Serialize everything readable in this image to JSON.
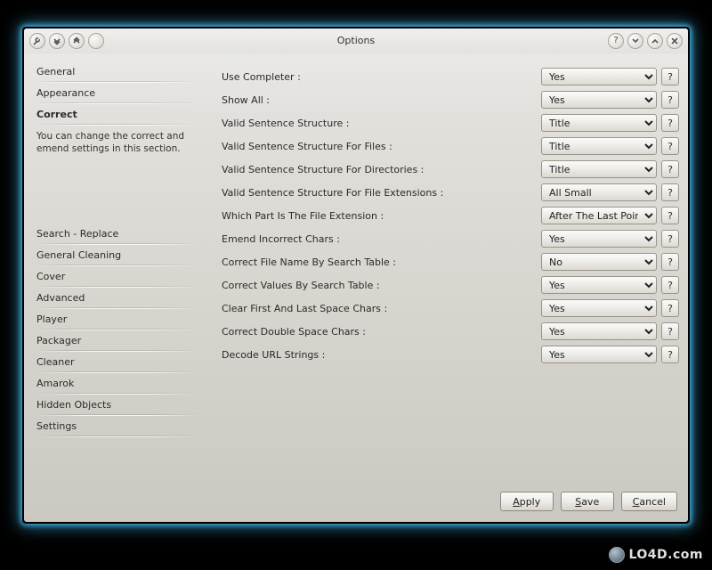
{
  "window": {
    "title": "Options"
  },
  "sidebar": {
    "tabs_top": [
      {
        "label": "General"
      },
      {
        "label": "Appearance"
      },
      {
        "label": "Correct",
        "active": true
      }
    ],
    "description": "You can change the correct and emend settings in this section.",
    "tabs_bottom": [
      {
        "label": "Search - Replace"
      },
      {
        "label": "General Cleaning"
      },
      {
        "label": "Cover"
      },
      {
        "label": "Advanced"
      },
      {
        "label": "Player"
      },
      {
        "label": "Packager"
      },
      {
        "label": "Cleaner"
      },
      {
        "label": "Amarok"
      },
      {
        "label": "Hidden Objects"
      },
      {
        "label": "Settings"
      }
    ]
  },
  "settings": [
    {
      "label": "Use Completer :",
      "value": "Yes"
    },
    {
      "label": "Show All :",
      "value": "Yes"
    },
    {
      "label": "Valid Sentence Structure :",
      "value": "Title"
    },
    {
      "label": "Valid Sentence Structure For Files :",
      "value": "Title"
    },
    {
      "label": "Valid Sentence Structure For Directories :",
      "value": "Title"
    },
    {
      "label": "Valid Sentence Structure For File Extensions :",
      "value": "All Small"
    },
    {
      "label": "Which Part Is The File Extension :",
      "value": "After The Last Point"
    },
    {
      "label": "Emend Incorrect Chars :",
      "value": "Yes"
    },
    {
      "label": "Correct File Name By Search Table :",
      "value": "No"
    },
    {
      "label": "Correct Values By Search Table :",
      "value": "Yes"
    },
    {
      "label": "Clear First And Last Space Chars :",
      "value": "Yes"
    },
    {
      "label": "Correct Double Space Chars :",
      "value": "Yes"
    },
    {
      "label": "Decode URL Strings :",
      "value": "Yes"
    }
  ],
  "footer": {
    "apply": "Apply",
    "save": "Save",
    "cancel": "Cancel"
  },
  "help_glyph": "?",
  "watermark": "LO4D.com"
}
